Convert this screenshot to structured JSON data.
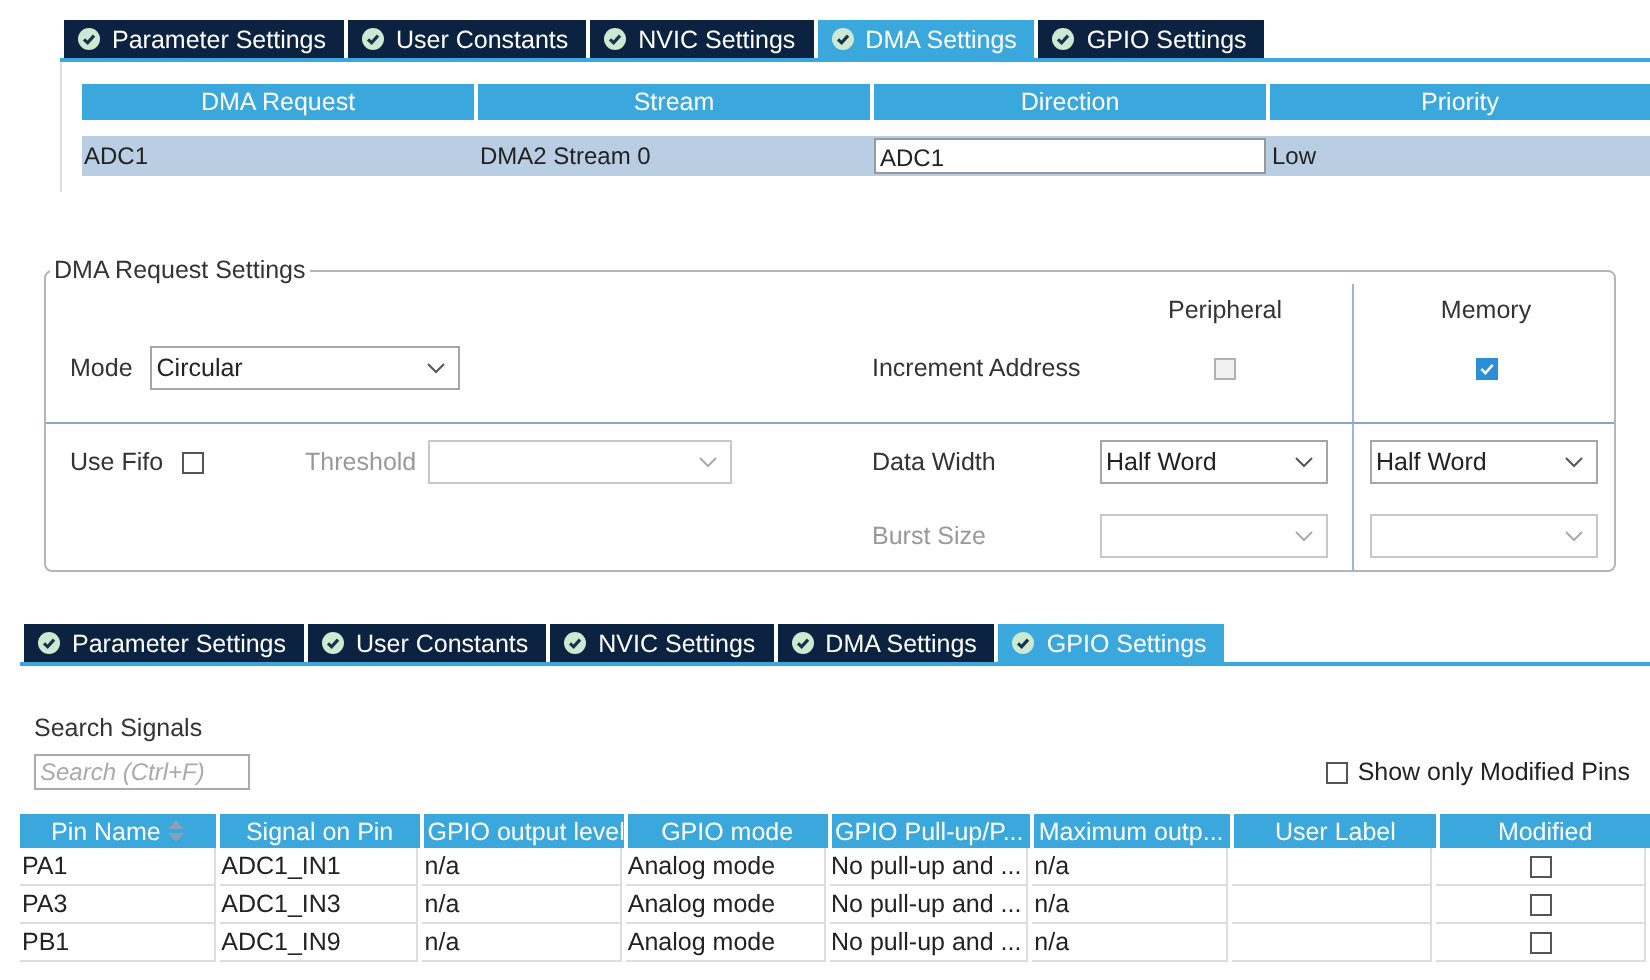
{
  "dma_panel": {
    "tabs": [
      {
        "label": "Parameter Settings",
        "selected": false
      },
      {
        "label": "User Constants",
        "selected": false
      },
      {
        "label": "NVIC Settings",
        "selected": false
      },
      {
        "label": "DMA Settings",
        "selected": true
      },
      {
        "label": "GPIO Settings",
        "selected": false
      }
    ],
    "table": {
      "columns": [
        "DMA Request",
        "Stream",
        "Direction",
        "Priority"
      ],
      "rows": [
        {
          "dma_request": "ADC1",
          "stream": "DMA2 Stream 0",
          "direction": "ADC1",
          "priority": "Low",
          "selected": true
        }
      ]
    },
    "request_settings": {
      "title": "DMA Request Settings",
      "peripheral_header": "Peripheral",
      "memory_header": "Memory",
      "mode_label": "Mode",
      "mode_value": "Circular",
      "increment_label": "Increment Address",
      "increment_peripheral": {
        "checked": false,
        "disabled": true
      },
      "increment_memory": {
        "checked": true,
        "disabled": false
      },
      "fifo_label": "Use Fifo",
      "fifo_checked": false,
      "threshold_label": "Threshold",
      "data_width_label": "Data Width",
      "data_width_peripheral": "Half Word",
      "data_width_memory": "Half Word",
      "burst_label": "Burst Size"
    }
  },
  "gpio_panel": {
    "tabs": [
      {
        "label": "Parameter Settings",
        "selected": false
      },
      {
        "label": "User Constants",
        "selected": false
      },
      {
        "label": "NVIC Settings",
        "selected": false
      },
      {
        "label": "DMA Settings",
        "selected": false
      },
      {
        "label": "GPIO Settings",
        "selected": true
      }
    ],
    "search_label": "Search Signals",
    "search": {
      "placeholder": "Search (Ctrl+F)"
    },
    "show_modified": {
      "label": "Show only Modified Pins",
      "checked": false
    },
    "table": {
      "columns": [
        "Pin Name",
        "Signal on Pin",
        "GPIO output level",
        "GPIO mode",
        "GPIO Pull-up/P...",
        "Maximum outp...",
        "User Label",
        "Modified"
      ],
      "rows": [
        {
          "pin": "PA1",
          "signal": "ADC1_IN1",
          "output_level": "n/a",
          "mode": "Analog mode",
          "pull": "No pull-up and ...",
          "max_speed": "n/a",
          "modified": false
        },
        {
          "pin": "PA3",
          "signal": "ADC1_IN3",
          "output_level": "n/a",
          "mode": "Analog mode",
          "pull": "No pull-up and ...",
          "max_speed": "n/a",
          "modified": false
        },
        {
          "pin": "PB1",
          "signal": "ADC1_IN9",
          "output_level": "n/a",
          "mode": "Analog mode",
          "pull": "No pull-up and ...",
          "max_speed": "n/a",
          "modified": false
        }
      ]
    }
  }
}
